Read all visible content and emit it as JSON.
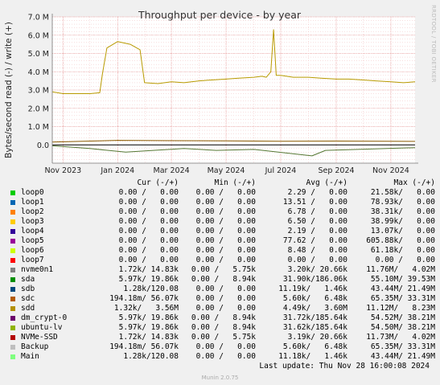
{
  "chart_data": {
    "type": "line",
    "title": "Throughput per device - by year",
    "ylabel": "Bytes/second read (-) / write (+)",
    "ylim": [
      -1000000,
      7000000
    ],
    "ytick_values": [
      0,
      1000000,
      2000000,
      3000000,
      4000000,
      5000000,
      6000000,
      7000000
    ],
    "ytick_labels": [
      "0.0",
      "1.0 M",
      "2.0 M",
      "3.0 M",
      "4.0 M",
      "5.0 M",
      "6.0 M",
      "7.0 M"
    ],
    "x_range": [
      "2023-10-20",
      "2024-11-28"
    ],
    "xtick_dates": [
      "2023-11-01",
      "2024-01-01",
      "2024-03-01",
      "2024-05-01",
      "2024-07-01",
      "2024-09-01",
      "2024-11-01"
    ],
    "xtick_labels": [
      "Nov 2023",
      "Jan 2024",
      "Mar 2024",
      "May 2024",
      "Jul 2024",
      "Sep 2024",
      "Nov 2024"
    ],
    "grid": true,
    "series": [
      {
        "name": "sdd",
        "color": "#b89a00",
        "x": [
          "2023-10-20",
          "2023-11-01",
          "2023-11-15",
          "2023-12-01",
          "2023-12-12",
          "2023-12-15",
          "2023-12-20",
          "2024-01-01",
          "2024-01-15",
          "2024-01-26",
          "2024-01-31",
          "2024-02-15",
          "2024-03-01",
          "2024-03-15",
          "2024-04-01",
          "2024-04-15",
          "2024-05-01",
          "2024-05-15",
          "2024-06-01",
          "2024-06-10",
          "2024-06-15",
          "2024-06-20",
          "2024-06-23",
          "2024-06-26",
          "2024-07-01",
          "2024-07-15",
          "2024-08-01",
          "2024-08-15",
          "2024-09-01",
          "2024-09-15",
          "2024-10-01",
          "2024-10-15",
          "2024-11-01",
          "2024-11-15",
          "2024-11-28"
        ],
        "values": [
          2900000,
          2800000,
          2800000,
          2800000,
          2850000,
          3900000,
          5300000,
          5650000,
          5500000,
          5200000,
          3400000,
          3350000,
          3450000,
          3400000,
          3500000,
          3550000,
          3600000,
          3650000,
          3700000,
          3750000,
          3700000,
          4000000,
          6300000,
          3800000,
          3800000,
          3700000,
          3700000,
          3650000,
          3600000,
          3600000,
          3550000,
          3500000,
          3450000,
          3400000,
          3450000
        ]
      },
      {
        "name": "sdc",
        "color": "#8a5a00",
        "x": [
          "2023-10-20",
          "2024-01-01",
          "2024-03-01",
          "2024-05-01",
          "2024-07-01",
          "2024-09-01",
          "2024-11-28"
        ],
        "values": [
          150000,
          250000,
          230000,
          220000,
          200000,
          210000,
          190000
        ]
      },
      {
        "name": "sda",
        "color": "#557733",
        "x": [
          "2023-10-20",
          "2023-12-01",
          "2024-01-10",
          "2024-03-15",
          "2024-04-20",
          "2024-06-01",
          "2024-08-05",
          "2024-08-20",
          "2024-11-28"
        ],
        "values": [
          -50000,
          -200000,
          -400000,
          -200000,
          -300000,
          -250000,
          -600000,
          -300000,
          -150000
        ]
      }
    ]
  },
  "side_text": "RRDTOOL / TOBI OETIKER",
  "legend": {
    "headers": {
      "cur": "Cur (-/+)",
      "min": "Min (-/+)",
      "avg": "Avg (-/+)",
      "max": "Max (-/+)"
    },
    "rows": [
      {
        "name": "loop0",
        "color": "#00cc00",
        "cur": "0.00 /   0.00",
        "min": "0.00 /   0.00",
        "avg": "2.29 /   0.00",
        "max": "21.58k/   0.00"
      },
      {
        "name": "loop1",
        "color": "#0066b3",
        "cur": "0.00 /   0.00",
        "min": "0.00 /   0.00",
        "avg": "13.51 /   0.00",
        "max": "78.93k/   0.00"
      },
      {
        "name": "loop2",
        "color": "#ff8000",
        "cur": "0.00 /   0.00",
        "min": "0.00 /   0.00",
        "avg": "6.78 /   0.00",
        "max": "38.31k/   0.00"
      },
      {
        "name": "loop3",
        "color": "#ffcc00",
        "cur": "0.00 /   0.00",
        "min": "0.00 /   0.00",
        "avg": "6.50 /   0.00",
        "max": "38.99k/   0.00"
      },
      {
        "name": "loop4",
        "color": "#330099",
        "cur": "0.00 /   0.00",
        "min": "0.00 /   0.00",
        "avg": "2.19 /   0.00",
        "max": "13.07k/   0.00"
      },
      {
        "name": "loop5",
        "color": "#990099",
        "cur": "0.00 /   0.00",
        "min": "0.00 /   0.00",
        "avg": "77.62 /   0.00",
        "max": "605.88k/   0.00"
      },
      {
        "name": "loop6",
        "color": "#ccff00",
        "cur": "0.00 /   0.00",
        "min": "0.00 /   0.00",
        "avg": "8.48 /   0.00",
        "max": "61.18k/   0.00"
      },
      {
        "name": "loop7",
        "color": "#ff0000",
        "cur": "0.00 /   0.00",
        "min": "0.00 /   0.00",
        "avg": "0.00 /   0.00",
        "max": "0.00 /   0.00"
      },
      {
        "name": "nvme0n1",
        "color": "#808080",
        "cur": "1.72k/ 14.83k",
        "min": "0.00 /   5.75k",
        "avg": "3.20k/ 20.66k",
        "max": "11.76M/   4.02M"
      },
      {
        "name": "sda",
        "color": "#008f00",
        "cur": "5.97k/ 19.86k",
        "min": "0.00 /   8.94k",
        "avg": "31.90k/186.06k",
        "max": "55.10M/ 39.53M"
      },
      {
        "name": "sdb",
        "color": "#00487d",
        "cur": "1.28k/120.08",
        "min": "0.00 /   0.00",
        "avg": "11.19k/   1.46k",
        "max": "43.44M/ 21.49M"
      },
      {
        "name": "sdc",
        "color": "#b35a00",
        "cur": "194.18m/ 56.07k",
        "min": "0.00 /   0.00",
        "avg": "5.60k/   6.48k",
        "max": "65.35M/ 33.31M"
      },
      {
        "name": "sdd",
        "color": "#b38f00",
        "cur": "1.32k/   3.56M",
        "min": "0.00 /   0.00",
        "avg": "4.49k/   3.60M",
        "max": "11.12M/   8.23M"
      },
      {
        "name": "dm_crypt-0",
        "color": "#6b006b",
        "cur": "5.97k/ 19.86k",
        "min": "0.00 /   8.94k",
        "avg": "31.72k/185.64k",
        "max": "54.52M/ 38.21M"
      },
      {
        "name": "ubuntu-lv",
        "color": "#8fb300",
        "cur": "5.97k/ 19.86k",
        "min": "0.00 /   8.94k",
        "avg": "31.62k/185.64k",
        "max": "54.50M/ 38.21M"
      },
      {
        "name": "NVMe-SSD",
        "color": "#b30000",
        "cur": "1.72k/ 14.83k",
        "min": "0.00 /   5.75k",
        "avg": "3.19k/ 20.66k",
        "max": "11.73M/   4.02M"
      },
      {
        "name": "Backup",
        "color": "#bebebe",
        "cur": "194.18m/ 56.07k",
        "min": "0.00 /   0.00",
        "avg": "5.60k/   6.48k",
        "max": "65.35M/ 33.31M"
      },
      {
        "name": "Main",
        "color": "#80ff80",
        "cur": "1.28k/120.08",
        "min": "0.00 /   0.00",
        "avg": "11.18k/   1.46k",
        "max": "43.44M/ 21.49M"
      }
    ]
  },
  "last_update": "Last update: Thu Nov 28 16:00:08 2024",
  "footer": "Munin 2.0.75"
}
